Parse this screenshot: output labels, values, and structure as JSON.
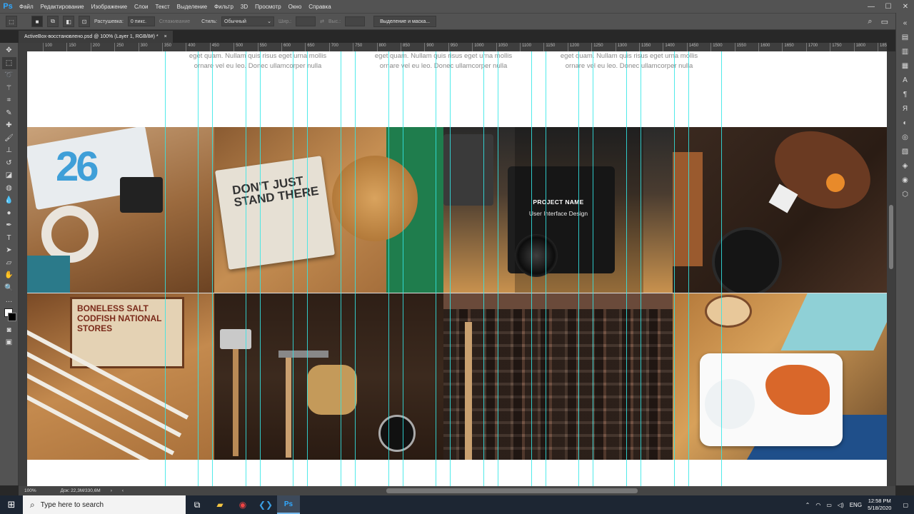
{
  "app": {
    "logo_text": "Ps"
  },
  "menu": {
    "items": [
      "Файл",
      "Редактирование",
      "Изображение",
      "Слои",
      "Текст",
      "Выделение",
      "Фильтр",
      "3D",
      "Просмотр",
      "Окно",
      "Справка"
    ]
  },
  "window_controls": {
    "minimize": "—",
    "maximize": "☐",
    "close": "✕"
  },
  "options_bar": {
    "feather_label": "Растушевка:",
    "feather_value": "0 пикс.",
    "antialias_label": "Сглаживание",
    "style_label": "Стиль:",
    "style_value": "Обычный",
    "width_label": "Шир.:",
    "height_label": "Выс.:",
    "select_mask_button": "Выделение и маска..."
  },
  "document": {
    "tab_title": "ActiveBox-восстановлено.psd @ 100% (Layer 1, RGB/8#) *",
    "tab_close": "×",
    "zoom": "100%",
    "doc_size": "Док: 22,3M/330,6M"
  },
  "ruler_ticks": [
    "100",
    "150",
    "200",
    "250",
    "300",
    "350",
    "400",
    "450",
    "500",
    "550",
    "600",
    "650",
    "700",
    "750",
    "800",
    "850",
    "900",
    "950",
    "1000",
    "1050",
    "1100",
    "1150",
    "1200",
    "1250",
    "1300",
    "1350",
    "1400",
    "1450",
    "1500",
    "1550",
    "1600",
    "1650",
    "1700",
    "1750",
    "1800",
    "1850"
  ],
  "canvas": {
    "lorem_line1": "eget quam. Nullam quis risus eget urna mollis",
    "lorem_line2": "ornare vel eu leo. Donec ullamcorper nulla",
    "project_name": "PROJECT NAME",
    "project_sub": "User Interface Design"
  },
  "tiles": [
    {
      "name": "tile-typography-desk",
      "caption": "26"
    },
    {
      "name": "tile-dont-just-stand-there",
      "caption": "DON'T JUST STAND THERE"
    },
    {
      "name": "tile-vintage-camera",
      "caption": ""
    },
    {
      "name": "tile-kitchen-spices",
      "caption": ""
    },
    {
      "name": "tile-pencils-boneless",
      "caption": "BONELESS SALT CODFISH NATIONAL STORES"
    },
    {
      "name": "tile-tools",
      "caption": ""
    },
    {
      "name": "tile-letterpress",
      "caption": ""
    },
    {
      "name": "tile-food-plate",
      "caption": ""
    }
  ],
  "taskbar": {
    "search_placeholder": "Type here to search",
    "lang": "ENG",
    "time": "12:58 PM",
    "date": "5/18/2020"
  },
  "colors": {
    "guide": "#33e6e6",
    "ps_blue": "#31a8ff",
    "panel": "#535353",
    "taskbar": "#1d2633"
  }
}
